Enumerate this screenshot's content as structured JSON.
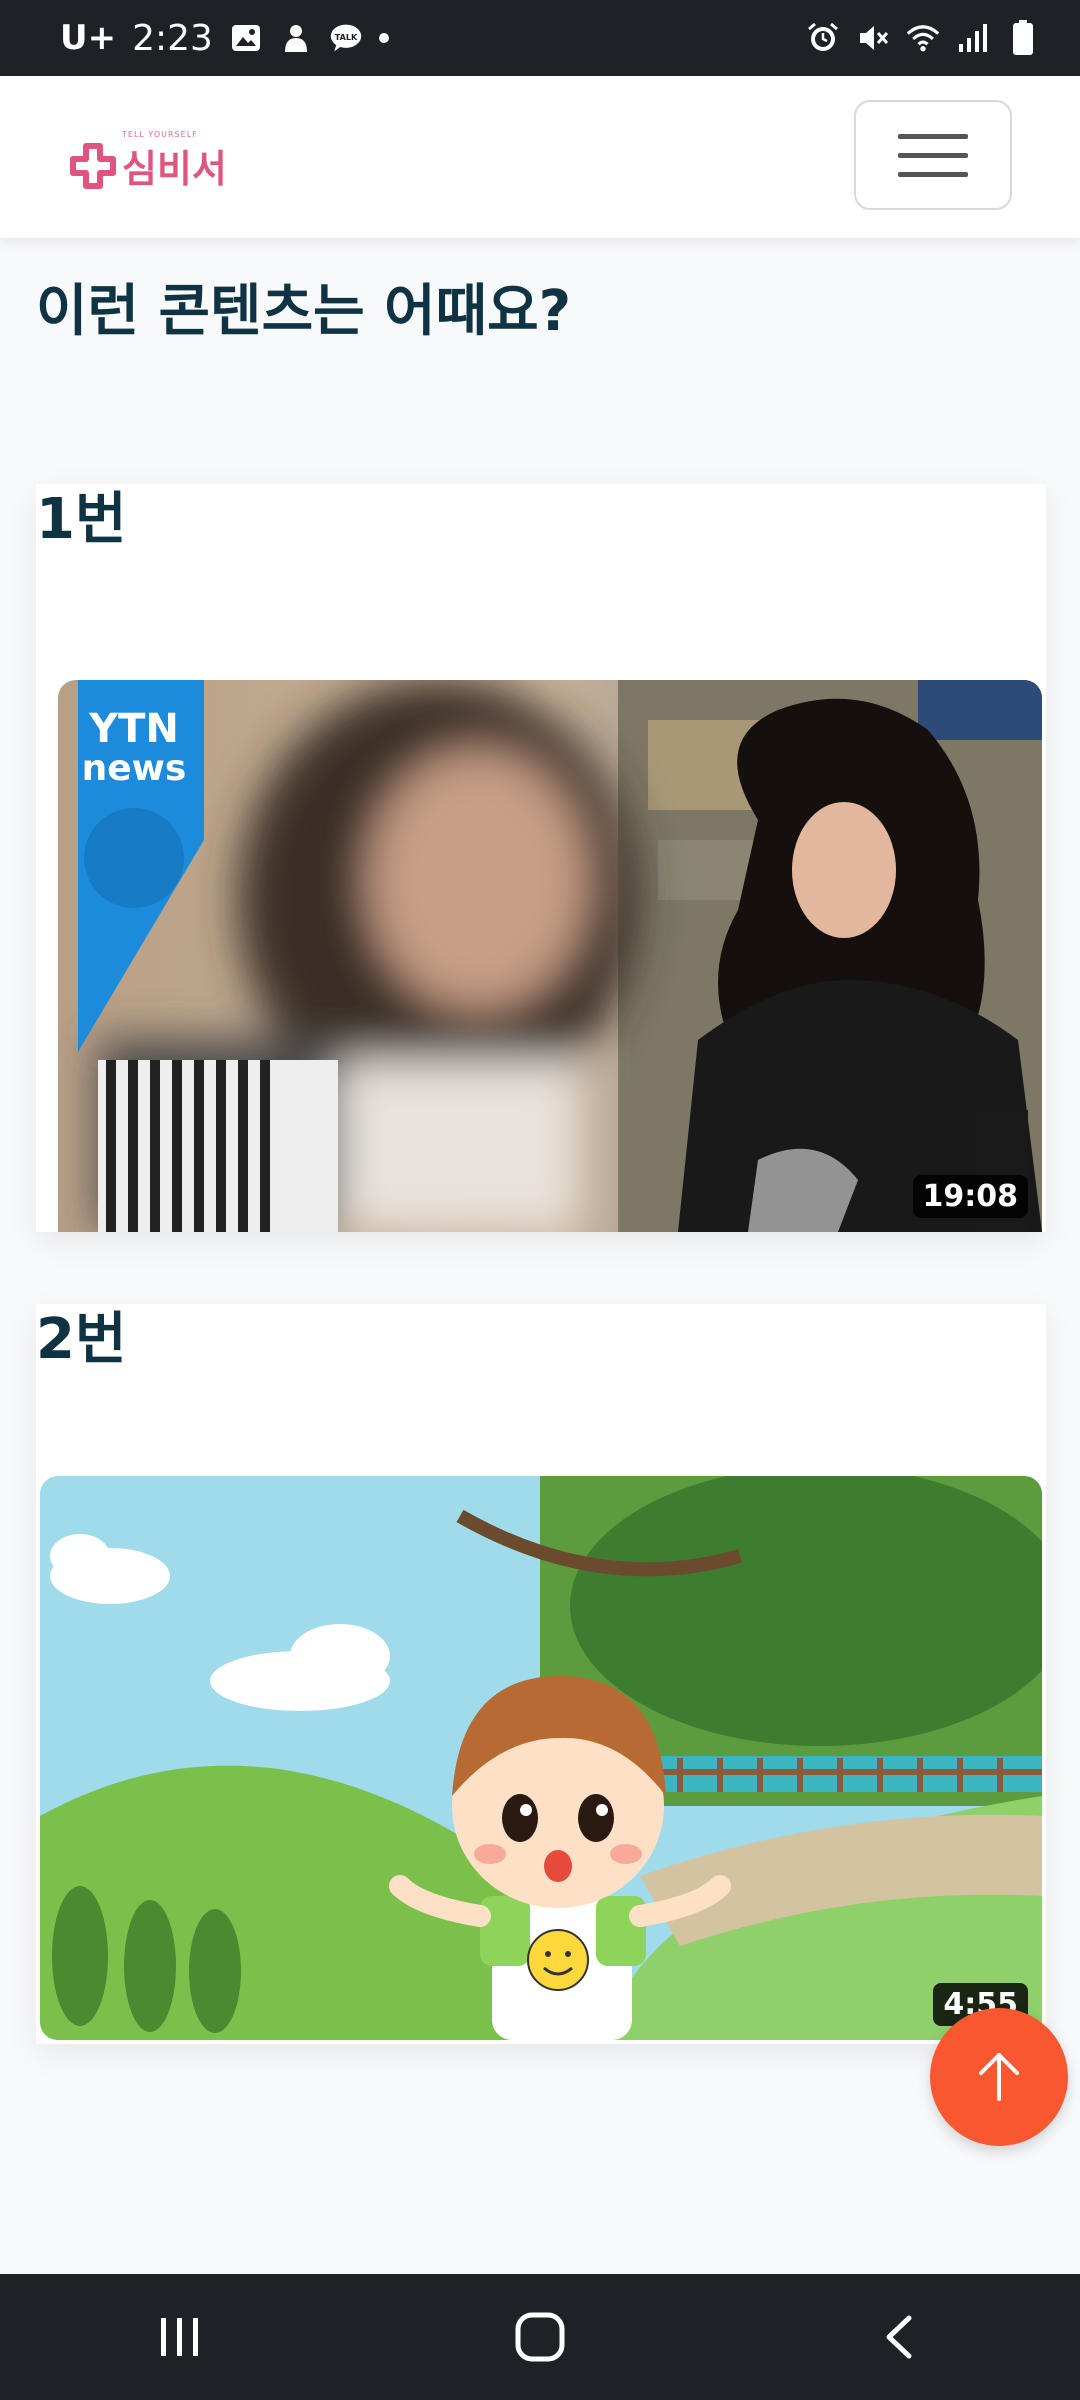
{
  "status_bar": {
    "carrier": "U+",
    "time": "2:23",
    "icons": [
      "gallery-icon",
      "app-icon",
      "talk-icon",
      "dot-icon",
      "alarm-icon",
      "mute-icon",
      "wifi-icon",
      "signal-icon",
      "battery-icon"
    ],
    "talk_label": "TALK"
  },
  "header": {
    "logo_tagline": "TELL YOURSELF",
    "logo_text": "심비서",
    "menu_icon": "hamburger-icon",
    "brand_color": "#e0557d"
  },
  "main": {
    "section_title": "이런 콘텐츠는 어때요?",
    "items": [
      {
        "label": "1번",
        "duration": "19:08",
        "thumbnail_logo_line1": "YTN",
        "thumbnail_logo_line2": "news"
      },
      {
        "label": "2번",
        "duration": "4:55"
      }
    ]
  },
  "scroll_top": {
    "icon": "arrow-up-icon",
    "color": "#f9572f"
  },
  "system_nav": {
    "icons": [
      "recent-apps-icon",
      "home-icon",
      "back-icon"
    ]
  }
}
